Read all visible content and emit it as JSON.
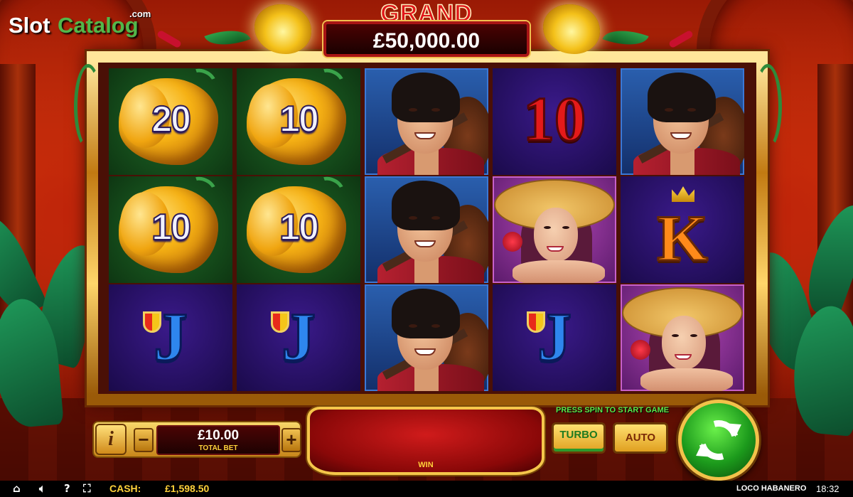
{
  "logo": {
    "word1": "Slot",
    "word2": "Catalog",
    "suffix": ".com"
  },
  "jackpot": {
    "title": "GRAND",
    "amount": "£50,000.00"
  },
  "reels": [
    {
      "symbols": [
        {
          "type": "pepper",
          "value": "20"
        },
        {
          "type": "pepper",
          "value": "10"
        },
        {
          "type": "J",
          "value": "J"
        }
      ]
    },
    {
      "symbols": [
        {
          "type": "pepper",
          "value": "10"
        },
        {
          "type": "pepper",
          "value": "10"
        },
        {
          "type": "J",
          "value": "J"
        }
      ]
    },
    {
      "symbols": [
        {
          "type": "man"
        },
        {
          "type": "man"
        },
        {
          "type": "man"
        }
      ]
    },
    {
      "symbols": [
        {
          "type": "ten",
          "value": "10"
        },
        {
          "type": "lady"
        },
        {
          "type": "J",
          "value": "J"
        }
      ]
    },
    {
      "symbols": [
        {
          "type": "man"
        },
        {
          "type": "K",
          "value": "K"
        },
        {
          "type": "lady"
        }
      ]
    }
  ],
  "controls": {
    "info_label": "i",
    "minus_label": "−",
    "plus_label": "+",
    "bet_value": "£10.00",
    "bet_label": "TOTAL BET",
    "win_label": "WIN",
    "press_spin": "PRESS SPIN TO START GAME",
    "turbo_label": "TURBO",
    "auto_label": "AUTO"
  },
  "status": {
    "home_icon": "home-icon",
    "sound_icon": "speaker-icon",
    "help_label": "?",
    "fullscreen_icon": "fullscreen-icon",
    "cash_label": "CASH:",
    "cash_value": "£1,598.50",
    "game_name": "LOCO HABANERO",
    "clock": "18:32"
  },
  "colors": {
    "frame_gold": "#e5a52c",
    "jackpot_red": "#e0151a",
    "spin_green": "#1c9a1c",
    "press_green": "#58e84a",
    "cash_yellow": "#ffd23a"
  }
}
